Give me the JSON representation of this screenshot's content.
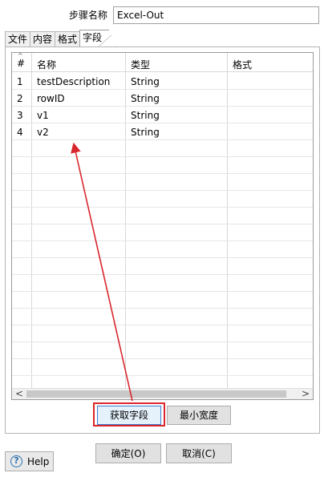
{
  "step": {
    "label": "步骤名称",
    "value": "Excel-Out"
  },
  "tabs": [
    "文件",
    "内容",
    "格式",
    "字段"
  ],
  "active_tab": "字段",
  "table": {
    "sort_mark": "^",
    "columns": [
      "#",
      "名称",
      "类型",
      "格式"
    ],
    "rows": [
      {
        "num": "1",
        "name": "testDescription",
        "type": "String",
        "format": ""
      },
      {
        "num": "2",
        "name": "rowID",
        "type": "String",
        "format": ""
      },
      {
        "num": "3",
        "name": "v1",
        "type": "String",
        "format": ""
      },
      {
        "num": "4",
        "name": "v2",
        "type": "String",
        "format": ""
      }
    ],
    "scroll_left_glyph": "<",
    "scroll_right_glyph": ">"
  },
  "buttons": {
    "get_fields": "获取字段",
    "min_width": "最小宽度",
    "ok": "确定(O)",
    "cancel": "取消(C)",
    "help": "Help",
    "help_glyph": "?"
  },
  "annotation_color": "#d9262c"
}
